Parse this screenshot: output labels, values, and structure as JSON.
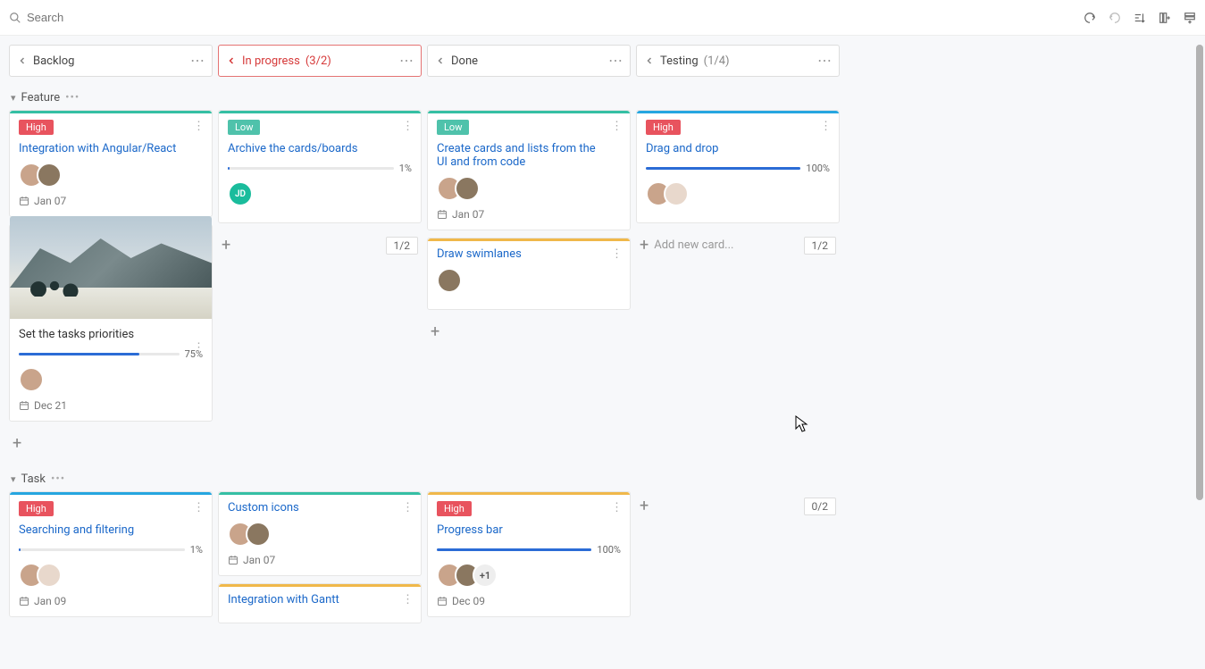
{
  "search": {
    "placeholder": "Search"
  },
  "columns": [
    {
      "title": "Backlog",
      "count": "",
      "active": false
    },
    {
      "title": "In progress",
      "count": " (3/2)",
      "active": true
    },
    {
      "title": "Done",
      "count": "",
      "active": false
    },
    {
      "title": "Testing",
      "count": " (1/4)",
      "active": false
    }
  ],
  "swimlanes": {
    "feature": {
      "label": "Feature"
    },
    "task": {
      "label": "Task"
    }
  },
  "feature": {
    "backlog": {
      "card1": {
        "tag": "High",
        "title": "Integration with Angular/React",
        "date": "Jan 07"
      },
      "card2": {
        "title": "Set the tasks priorities",
        "progress": 75,
        "progress_label": "75%",
        "date": "Dec 21"
      }
    },
    "inprogress": {
      "card1": {
        "tag": "Low",
        "title": "Archive the cards/boards",
        "progress": 1,
        "progress_label": "1%",
        "avatar_initials": "JD"
      },
      "footer_count": "1/2"
    },
    "done": {
      "card1": {
        "tag": "Low",
        "title": "Create cards and lists from the UI and from code",
        "date": "Jan 07"
      },
      "card2": {
        "title": "Draw swimlanes"
      }
    },
    "testing": {
      "card1": {
        "tag": "High",
        "title": "Drag and drop",
        "progress": 100,
        "progress_label": "100%"
      },
      "add_label": "Add new card...",
      "footer_count": "1/2"
    }
  },
  "task": {
    "backlog": {
      "card1": {
        "tag": "High",
        "title": "Searching and filtering",
        "progress": 1,
        "progress_label": "1%",
        "date": "Jan 09"
      }
    },
    "inprogress": {
      "card1": {
        "title": "Custom icons",
        "date": "Jan 07"
      },
      "card2": {
        "title": "Integration with Gantt"
      }
    },
    "done": {
      "card1": {
        "tag": "High",
        "title": "Progress bar",
        "progress": 100,
        "progress_label": "100%",
        "avatar_extra": "+1",
        "date": "Dec 09"
      }
    },
    "testing": {
      "footer_count": "0/2"
    }
  }
}
